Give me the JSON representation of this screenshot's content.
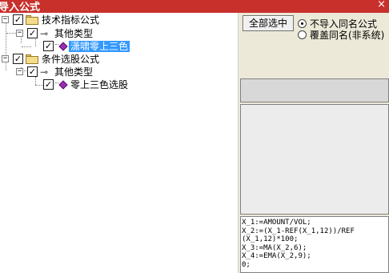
{
  "window": {
    "title": "导入公式",
    "close_glyph": "×"
  },
  "tree": {
    "nodes": [
      {
        "label": "技术指标公式",
        "checked": true,
        "expander": "−"
      },
      {
        "label": "其他类型",
        "checked": true,
        "expander": "−"
      },
      {
        "label": "潇啸零上三色",
        "checked": true,
        "selected": true
      },
      {
        "label": "条件选股公式",
        "checked": true,
        "expander": "−"
      },
      {
        "label": "其他类型",
        "checked": true,
        "expander": "−"
      },
      {
        "label": "零上三色选股",
        "checked": true
      }
    ]
  },
  "panel": {
    "select_all_label": "全部选中",
    "radio_options": [
      {
        "label": "不导入同名公式",
        "selected": true
      },
      {
        "label": "覆盖同名(非系统)",
        "selected": false
      }
    ],
    "code_lines": [
      "X_1:=AMOUNT/VOL;",
      "X_2:=(X_1-REF(X_1,12))/REF",
      "(X_1,12)*100;",
      "X_3:=MA(X_2,6);",
      "X_4:=EMA(X_2,9);",
      "0;"
    ]
  },
  "colors": {
    "titlebar": "#c8302c",
    "selection": "#3399ff",
    "panel_bg": "#ece9d8",
    "item_icon": "#9b2cb0",
    "folder": "#f3dc8c"
  },
  "check_glyph": "✓"
}
